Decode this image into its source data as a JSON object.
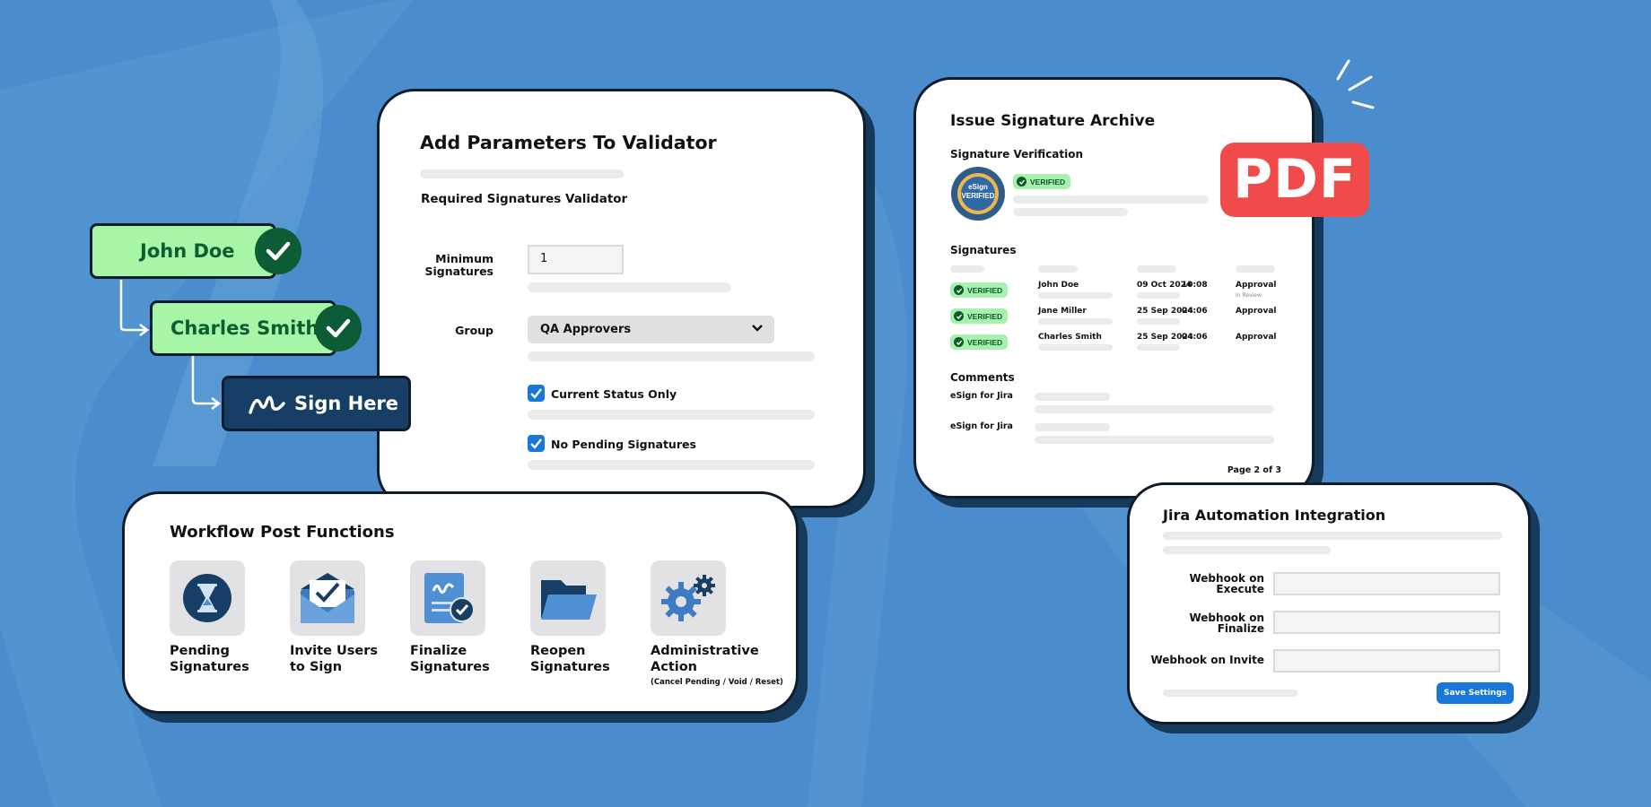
{
  "colors": {
    "background": "#4a8ccc",
    "card_border": "#0f1c2b",
    "accent_blue": "#1877d9",
    "verified_green": "#a7f0ad",
    "pdf_red": "#f04a4a",
    "chip_green": "#a9f5a8",
    "chip_dark": "#173f66"
  },
  "chips": {
    "john": "John Doe",
    "charles": "Charles Smith",
    "sign": "Sign Here"
  },
  "validator": {
    "title": "Add Parameters To Validator",
    "subtitle": "Required Signatures Validator",
    "min_sig_label_1": "Minimum",
    "min_sig_label_2": "Signatures",
    "min_sig_value": "1",
    "group_label": "Group",
    "group_value": "QA Approvers",
    "checkbox_1": "Current Status Only",
    "checkbox_2": "No Pending Signatures"
  },
  "archive": {
    "title": "Issue Signature Archive",
    "sig_verification": "Signature Verification",
    "seal_line1": "eSign",
    "seal_line2": "VERIFIED",
    "verified": "VERIFIED",
    "signatures_head": "Signatures",
    "rows": [
      {
        "status": "VERIFIED",
        "name": "John Doe",
        "date": "09 Oct 2024",
        "time": "10:08",
        "type": "Approval",
        "sub": "In Review"
      },
      {
        "status": "VERIFIED",
        "name": "Jane Miller",
        "date": "25 Sep 2024",
        "time": "04:06",
        "type": "Approval",
        "sub": ""
      },
      {
        "status": "VERIFIED",
        "name": "Charles Smith",
        "date": "25 Sep 2024",
        "time": "04:06",
        "type": "Approval",
        "sub": ""
      }
    ],
    "comments_head": "Comments",
    "comment_1": "eSign for Jira",
    "comment_2": "eSign for Jira",
    "page": "Page 2 of 3"
  },
  "pdf": "PDF",
  "workflow": {
    "title": "Workflow Post Functions",
    "items": [
      {
        "l1": "Pending",
        "l2": "Signatures",
        "icon": "hourglass-icon"
      },
      {
        "l1": "Invite Users",
        "l2": "to Sign",
        "icon": "envelope-icon"
      },
      {
        "l1": "Finalize",
        "l2": "Signatures",
        "icon": "signed-document-icon"
      },
      {
        "l1": "Reopen",
        "l2": "Signatures",
        "icon": "folder-icon"
      },
      {
        "l1": "Administrative",
        "l2": "Action",
        "icon": "gears-icon"
      }
    ],
    "admin_note": "(Cancel Pending / Void / Reset)"
  },
  "jira": {
    "title": "Jira Automation Integration",
    "execute_1": "Webhook on",
    "execute_2": "Execute",
    "finalize_1": "Webhook on",
    "finalize_2": "Finalize",
    "invite": "Webhook on Invite",
    "save": "Save Settings"
  }
}
